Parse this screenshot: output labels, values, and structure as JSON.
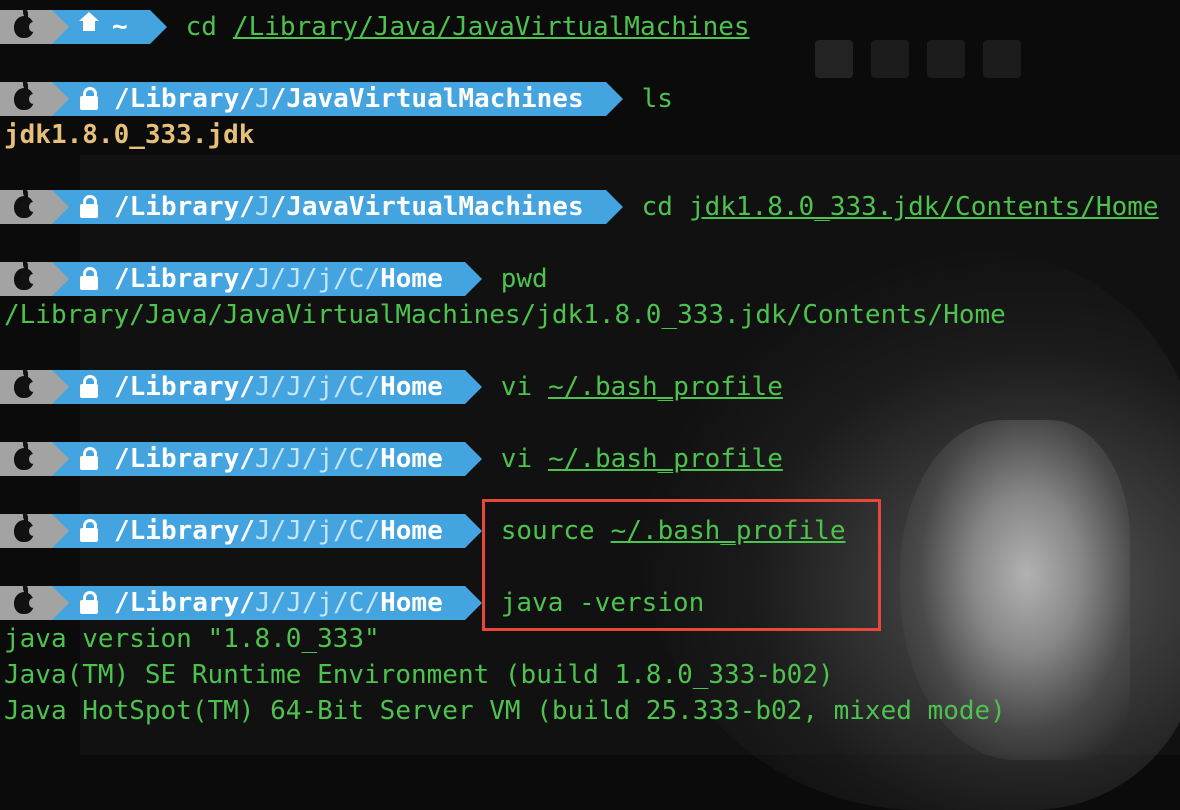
{
  "prompts": [
    {
      "kind": "home",
      "home_label": "~",
      "command": "cd",
      "argument": "/Library/Java/JavaVirtualMachines"
    },
    {
      "kind": "lock",
      "path_parts": [
        "/Library/",
        "J",
        "/JavaVirtualMachines"
      ],
      "command": "ls",
      "argument": ""
    },
    {
      "kind": "lock",
      "path_parts": [
        "/Library/",
        "J",
        "/JavaVirtualMachines"
      ],
      "command": "cd",
      "argument": "jdk1.8.0_333.jdk/Contents/Home"
    },
    {
      "kind": "lock",
      "path_parts": [
        "/Library/",
        "J/J/j/C/",
        "Home"
      ],
      "command": "pwd",
      "argument": ""
    },
    {
      "kind": "lock",
      "path_parts": [
        "/Library/",
        "J/J/j/C/",
        "Home"
      ],
      "command": "vi",
      "argument": "~/.bash_profile"
    },
    {
      "kind": "lock",
      "path_parts": [
        "/Library/",
        "J/J/j/C/",
        "Home"
      ],
      "command": "vi",
      "argument": "~/.bash_profile"
    },
    {
      "kind": "lock",
      "path_parts": [
        "/Library/",
        "J/J/j/C/",
        "Home"
      ],
      "command": "source",
      "argument": "~/.bash_profile"
    },
    {
      "kind": "lock",
      "path_parts": [
        "/Library/",
        "J/J/j/C/",
        "Home"
      ],
      "command": "java -version",
      "argument": ""
    }
  ],
  "outputs": {
    "ls_result": "jdk1.8.0_333.jdk",
    "pwd_result": "/Library/Java/JavaVirtualMachines/jdk1.8.0_333.jdk/Contents/Home",
    "java_version": [
      "java version \"1.8.0_333\"",
      "Java(TM) SE Runtime Environment (build 1.8.0_333-b02)",
      "Java HotSpot(TM) 64-Bit Server VM (build 25.333-b02, mixed mode)"
    ]
  },
  "colors": {
    "prompt_os": "#a3a3a3",
    "prompt_path": "#44a4e0",
    "command_text": "#4ec24e",
    "ls_output": "#e6c07b",
    "highlight": "#e8473a"
  },
  "icons": {
    "os": "apple-icon",
    "home": "home-icon",
    "lock": "lock-icon"
  }
}
